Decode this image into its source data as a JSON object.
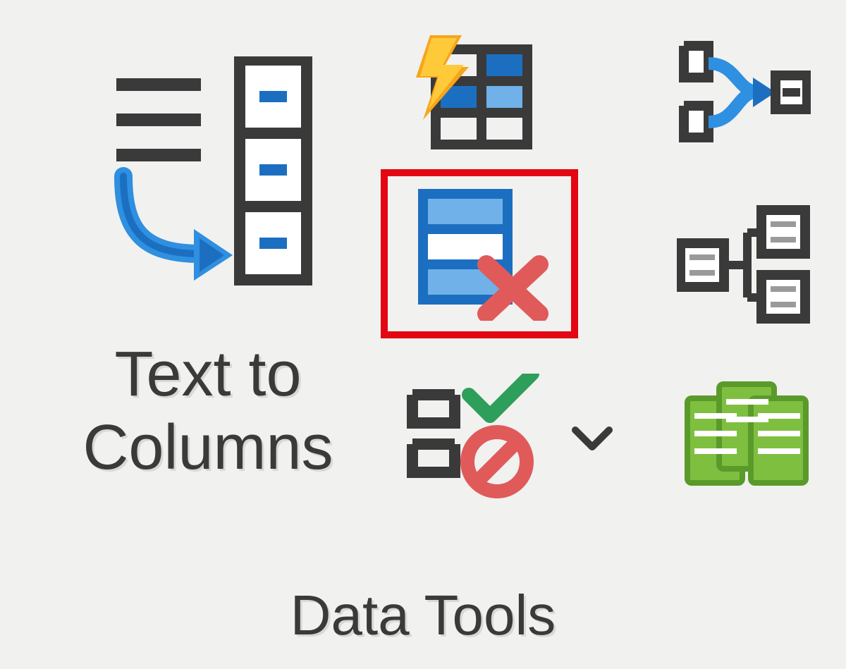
{
  "group": {
    "label": "Data Tools"
  },
  "buttons": {
    "text_to_columns": {
      "label": "Text to\nColumns"
    }
  },
  "icons": {
    "text_to_columns": "text-to-columns-icon",
    "flash_fill": "flash-fill-icon",
    "remove_duplicates": "remove-duplicates-icon",
    "data_validation": "data-validation-icon",
    "consolidate": "consolidate-icon",
    "relationships": "relationships-icon",
    "data_model": "manage-data-model-icon"
  },
  "highlight": {
    "target": "remove-duplicates-button"
  }
}
